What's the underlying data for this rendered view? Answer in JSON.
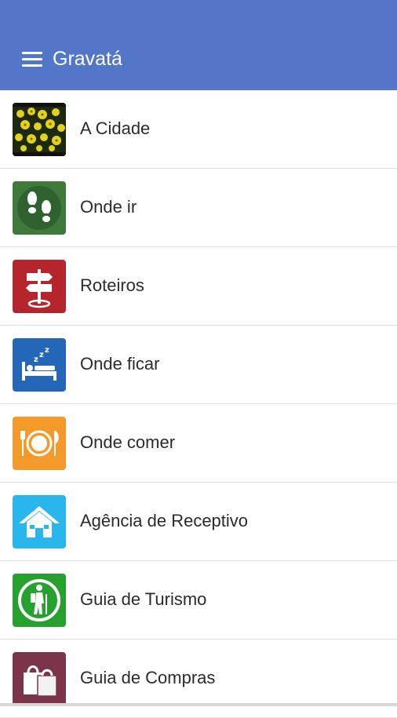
{
  "appbar": {
    "title": "Gravatá",
    "background": "#5476c8",
    "menu_icon": "hamburger-menu-icon"
  },
  "menu": {
    "items": [
      {
        "label": "A Cidade",
        "icon": "yellow-flowers-photo",
        "color": "#d9c81a"
      },
      {
        "label": "Onde ir",
        "icon": "footprints-icon",
        "color": "#3f7a3a"
      },
      {
        "label": "Roteiros",
        "icon": "signpost-icon",
        "color": "#b5252b"
      },
      {
        "label": "Onde ficar",
        "icon": "bed-icon",
        "color": "#2467b8"
      },
      {
        "label": "Onde comer",
        "icon": "plate-cutlery-icon",
        "color": "#f39a2b"
      },
      {
        "label": "Agência de Receptivo",
        "icon": "house-icon",
        "color": "#29b6ec"
      },
      {
        "label": "Guia de Turismo",
        "icon": "hiker-icon",
        "color": "#26a12e"
      },
      {
        "label": "Guia de Compras",
        "icon": "shopping-bags-icon",
        "color": "#7b3448"
      }
    ]
  }
}
